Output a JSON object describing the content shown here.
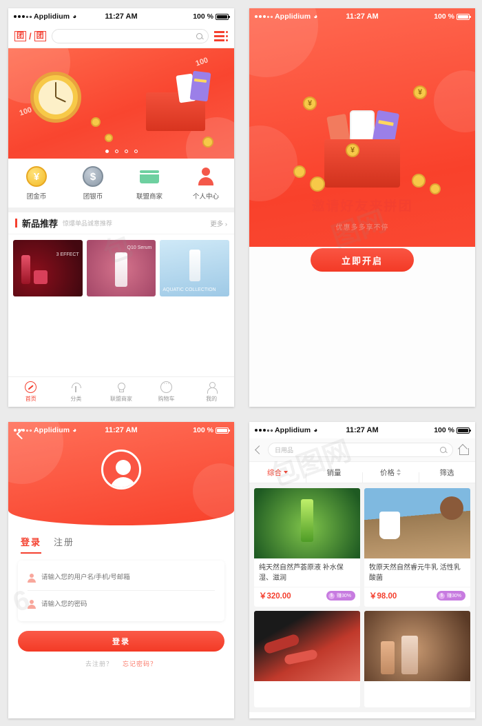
{
  "status_bar": {
    "carrier": "Applidium",
    "time": "11:27 AM",
    "battery": "100 %",
    "wifi_icon": "wifi-icon",
    "signal_icon": "signal-dots-icon"
  },
  "screen_home": {
    "logo_left": "团",
    "logo_sep": "/",
    "logo_right": "团",
    "search_placeholder": "",
    "search_icon": "search-icon",
    "menu_icon": "hamburger-menu-icon",
    "banner": {
      "tag_text": "100",
      "dots_total": 4,
      "active_dot": 1
    },
    "quicknav": [
      {
        "label": "团金币",
        "icon": "gold-coin-icon",
        "symbol": "¥"
      },
      {
        "label": "团银币",
        "icon": "silver-coin-icon",
        "symbol": "$"
      },
      {
        "label": "联盟商家",
        "icon": "storefront-icon",
        "symbol": ""
      },
      {
        "label": "个人中心",
        "icon": "user-profile-icon",
        "symbol": ""
      }
    ],
    "section": {
      "title": "新品推荐",
      "subtitle": "惊爆单品诚意推荐",
      "more": "更多 ›"
    },
    "products": [
      {
        "caption": "3 EFFECT"
      },
      {
        "caption": "Q10 Serum"
      },
      {
        "caption": "AQUATIC COLLECTION"
      }
    ],
    "tabbar": [
      {
        "label": "首页",
        "icon": "compass-icon",
        "active": true
      },
      {
        "label": "分类",
        "icon": "leaf-icon",
        "active": false
      },
      {
        "label": "联盟商家",
        "icon": "bulb-icon",
        "active": false
      },
      {
        "label": "购物车",
        "icon": "cart-icon",
        "active": false
      },
      {
        "label": "我的",
        "icon": "person-icon",
        "active": false
      }
    ]
  },
  "screen_invite": {
    "title": "邀请好友来拼团",
    "subtitle": "优惠多多享不停",
    "button": "立即开启",
    "yen_symbol": "¥"
  },
  "screen_login": {
    "back_icon": "back-chevron-icon",
    "avatar_icon": "avatar-icon",
    "tabs": [
      {
        "label": "登录",
        "active": true
      },
      {
        "label": "注册",
        "active": false
      }
    ],
    "fields": [
      {
        "placeholder": "请输入您的用户名/手机/号邮箱",
        "icon": "user-icon",
        "value": ""
      },
      {
        "placeholder": "请输入您的密码",
        "icon": "lock-user-icon",
        "value": ""
      }
    ],
    "submit": "登录",
    "links": [
      {
        "label": "去注册？",
        "highlight": false
      },
      {
        "label": "忘记密码？",
        "highlight": true
      }
    ]
  },
  "screen_list": {
    "back_icon": "back-chevron-icon",
    "home_icon": "home-icon",
    "search_icon": "search-icon",
    "search_value": "日用品",
    "filters": [
      {
        "label": "综合",
        "indicator": "chevron-down-icon",
        "active": true
      },
      {
        "label": "销量",
        "indicator": "",
        "active": false
      },
      {
        "label": "价格",
        "indicator": "sort-updown-icon",
        "active": false
      },
      {
        "label": "筛选",
        "indicator": "",
        "active": false
      }
    ],
    "products": [
      {
        "name": "纯天然自然芦荟原液  补水保湿、滋润",
        "price": "￥320.00",
        "badge": "赚30%",
        "image": "aloe"
      },
      {
        "name": "牧原天然自然睿元牛乳  活性乳酸菌",
        "price": "￥98.00",
        "badge": "赚30%",
        "image": "milk"
      },
      {
        "name": "",
        "price": "",
        "badge": "",
        "image": "lips"
      },
      {
        "name": "",
        "price": "",
        "badge": "",
        "image": "perf"
      }
    ]
  },
  "colors": {
    "brand_red": "#f4402f",
    "badge_purple": "#c77be0",
    "gold": "#f7c948",
    "silver": "#8c9aa8",
    "green": "#6ed0a0"
  }
}
